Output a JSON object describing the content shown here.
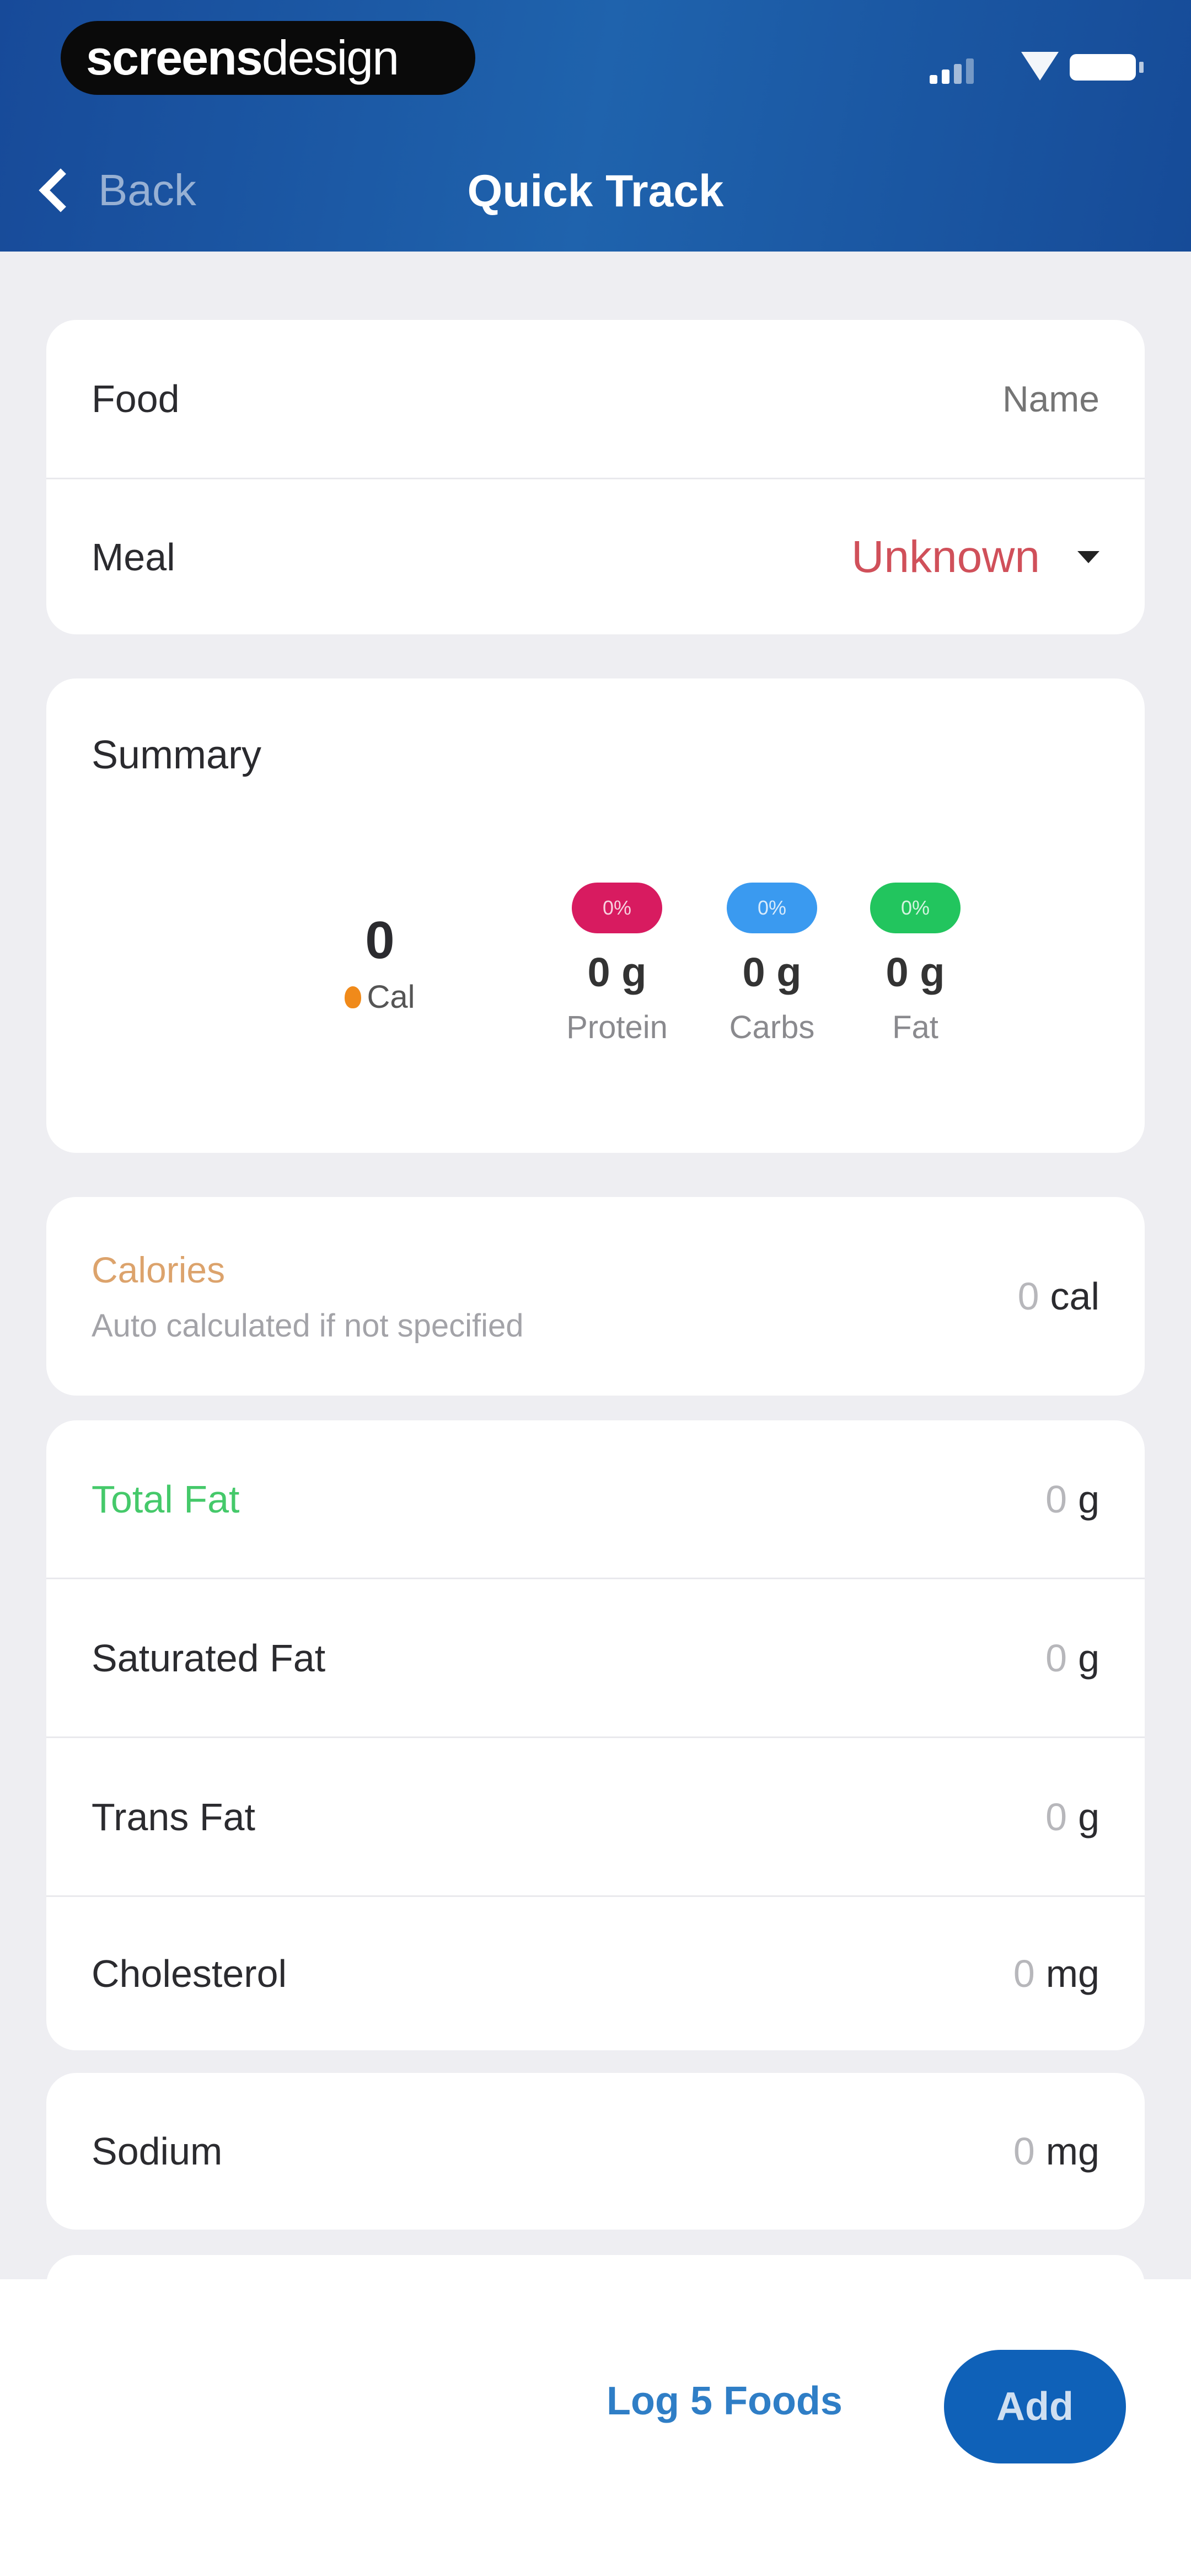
{
  "status_bar": {
    "logo_bold": "screens",
    "logo_light": "design",
    "icons": [
      "signal-icon",
      "wifi-icon",
      "battery-icon"
    ]
  },
  "nav": {
    "back_label": "Back",
    "title": "Quick Track"
  },
  "food_card": {
    "food_label": "Food",
    "food_placeholder": "Name",
    "meal_label": "Meal",
    "meal_value": "Unknown"
  },
  "summary": {
    "title": "Summary",
    "calories_value": "0",
    "calories_unit": "Cal",
    "macros": [
      {
        "percent": "0%",
        "value": "0 g",
        "label": "Protein",
        "color": "#d81b60"
      },
      {
        "percent": "0%",
        "value": "0 g",
        "label": "Carbs",
        "color": "#3a9af0"
      },
      {
        "percent": "0%",
        "value": "0 g",
        "label": "Fat",
        "color": "#22c55e"
      }
    ]
  },
  "calories_card": {
    "title": "Calories",
    "subtitle": "Auto calculated if not specified",
    "value": "0",
    "unit": "cal"
  },
  "nutrients": [
    {
      "label": "Total Fat",
      "value": "0",
      "unit": "g",
      "label_color": "#45c96a"
    },
    {
      "label": "Saturated Fat",
      "value": "0",
      "unit": "g"
    },
    {
      "label": "Trans Fat",
      "value": "0",
      "unit": "g"
    },
    {
      "label": "Cholesterol",
      "value": "0",
      "unit": "mg"
    }
  ],
  "sodium": {
    "label": "Sodium",
    "value": "0",
    "unit": "mg"
  },
  "bottom_bar": {
    "log_label": "Log 5 Foods",
    "add_label": "Add"
  },
  "colors": {
    "header_blue": "#1a55a0",
    "accent_blue": "#0f61b8",
    "meal_red": "#d0505a",
    "calories_orange": "#dca36c"
  }
}
